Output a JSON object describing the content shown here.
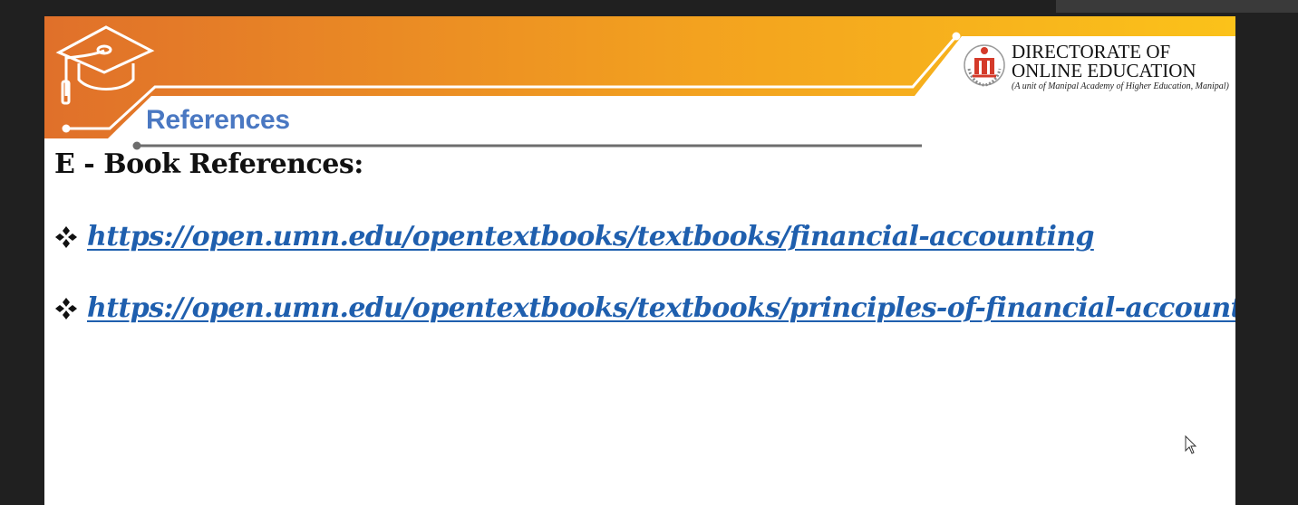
{
  "slide": {
    "title": "References",
    "colors": {
      "banner_start": "#e0702a",
      "banner_end": "#fbc21a",
      "title": "#4a78c2",
      "link": "#1f5fae"
    }
  },
  "logo": {
    "line1": "DIRECTORATE OF",
    "line2": "ONLINE EDUCATION",
    "subtitle": "(A unit of Manipal Academy of Higher Education, Manipal)"
  },
  "content": {
    "heading": "E - Book References:",
    "references": [
      {
        "bullet_icon": "four-diamond-bullet-icon",
        "url": "https://open.umn.edu/opentextbooks/textbooks/financial-accounting"
      },
      {
        "bullet_icon": "four-diamond-bullet-icon",
        "url": "https://open.umn.edu/opentextbooks/textbooks/principles-of-financial-accounting"
      }
    ]
  }
}
